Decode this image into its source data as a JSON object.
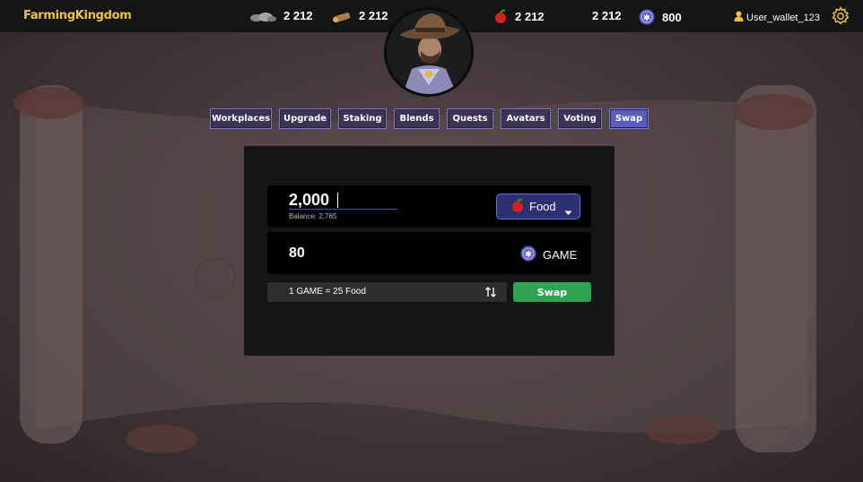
{
  "app": {
    "logo_text": "FarmingKingdom"
  },
  "resources": {
    "stone": "2 212",
    "wood": "2 212",
    "food": "2 212",
    "gold": "2 212",
    "game": "800"
  },
  "user": {
    "name": "User_wallet_123"
  },
  "nav": {
    "items": [
      "Workplaces",
      "Upgrade",
      "Staking",
      "Blends",
      "Quests",
      "Avatars",
      "Voting",
      "Swap"
    ],
    "active": "Swap"
  },
  "swap": {
    "from_amount": "2,000",
    "balance_label": "Balance: 2,765",
    "from_token": "Food",
    "to_amount": "80",
    "to_token": "GAME",
    "rate": "1 GAME = 25 Food",
    "button_label": "Swap"
  },
  "colors": {
    "accent": "#5a5bc4",
    "logo": "#f0c23d",
    "swap_button": "#2ea352",
    "select_bg": "#2c3070"
  },
  "icons": [
    "stone-icon",
    "wood-icon",
    "apple-icon",
    "game-token-icon",
    "user-icon",
    "gear-icon",
    "chevron-down-icon",
    "swap-direction-icon"
  ]
}
